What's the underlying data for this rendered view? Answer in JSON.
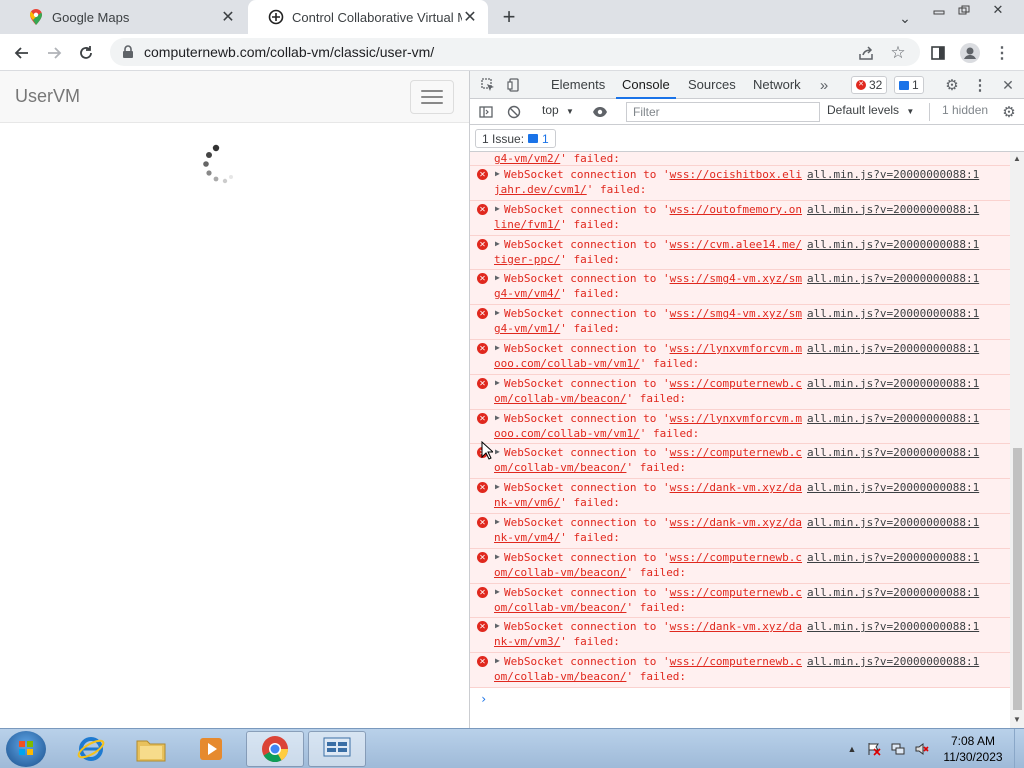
{
  "browser": {
    "tabs": [
      {
        "title": "Google Maps",
        "icon": "google-maps-icon"
      },
      {
        "title": "Control Collaborative Virtual Mac",
        "icon": "collabvm-icon"
      }
    ],
    "url": "computernewb.com/collab-vm/classic/user-vm/"
  },
  "page": {
    "brand": "UserVM"
  },
  "devtools": {
    "tabs": [
      "Elements",
      "Console",
      "Sources",
      "Network"
    ],
    "active_tab": "Console",
    "error_count": "32",
    "message_count": "1",
    "context": "top",
    "filter_placeholder": "Filter",
    "levels": "Default levels",
    "hidden": "1 hidden",
    "issues_label": "1 Issue:",
    "issues_count": "1",
    "first_partial": {
      "url_part": "g4-vm/vm2/",
      "tail": "' failed:"
    },
    "messages": [
      {
        "url1": "wss://ocishitbox.eli",
        "url2": "jahr.dev/cvm1/"
      },
      {
        "url1": "wss://outofmemory.on",
        "url2": "line/fvm1/"
      },
      {
        "url1": "wss://cvm.alee14.me/",
        "url2": "tiger-ppc/"
      },
      {
        "url1": "wss://smg4-vm.xyz/sm",
        "url2": "g4-vm/vm4/"
      },
      {
        "url1": "wss://smg4-vm.xyz/sm",
        "url2": "g4-vm/vm1/"
      },
      {
        "url1": "wss://lynxvmforcvm.m",
        "url2": "ooo.com/collab-vm/vm1/"
      },
      {
        "url1": "wss://computernewb.c",
        "url2": "om/collab-vm/beacon/"
      },
      {
        "url1": "wss://lynxvmforcvm.m",
        "url2": "ooo.com/collab-vm/vm1/"
      },
      {
        "url1": "wss://computernewb.c",
        "url2": "om/collab-vm/beacon/"
      },
      {
        "url1": "wss://dank-vm.xyz/da",
        "url2": "nk-vm/vm6/"
      },
      {
        "url1": "wss://dank-vm.xyz/da",
        "url2": "nk-vm/vm4/"
      },
      {
        "url1": "wss://computernewb.c",
        "url2": "om/collab-vm/beacon/"
      },
      {
        "url1": "wss://computernewb.c",
        "url2": "om/collab-vm/beacon/"
      },
      {
        "url1": "wss://dank-vm.xyz/da",
        "url2": "nk-vm/vm3/"
      },
      {
        "url1": "wss://computernewb.c",
        "url2": "om/collab-vm/beacon/"
      }
    ],
    "msg_prefix": "WebSocket connection to '",
    "msg_suffix": "' failed:",
    "source": "all.min.js?v=20000000088:1",
    "prompt": "›"
  },
  "taskbar": {
    "time": "7:08 AM",
    "date": "11/30/2023"
  }
}
